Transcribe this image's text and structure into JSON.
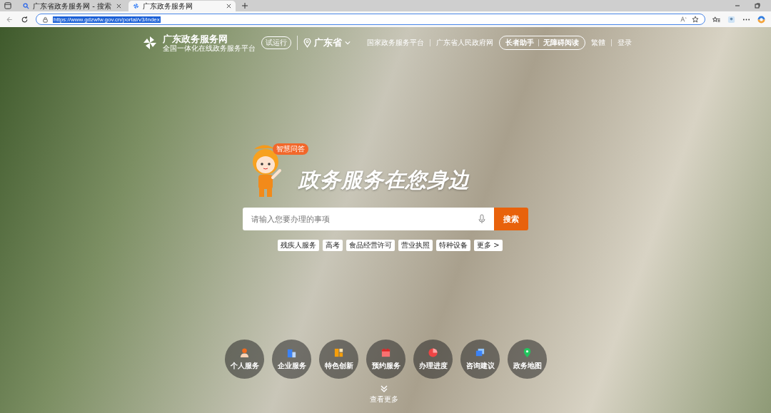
{
  "browser": {
    "tabs": [
      {
        "title": "广东省政务服务网 - 搜索",
        "selected": false,
        "kind": "search"
      },
      {
        "title": "广东政务服务网",
        "selected": true,
        "kind": "site"
      }
    ],
    "url": "https://www.gdzwfw.gov.cn/portal/v3/index"
  },
  "header": {
    "logo_title": "广东政务服务网",
    "logo_subtitle": "全国一体化在线政务服务平台",
    "badge": "试运行",
    "region": "广东省",
    "links": [
      "国家政务服务平台",
      "广东省人民政府网"
    ],
    "assist_buttons": [
      "长者助手",
      "无障碍阅读"
    ],
    "lang": "繁體",
    "login": "登录"
  },
  "hero": {
    "mascot_badge": "智慧问答",
    "headline": "政务服务在您身边",
    "search_placeholder": "请输入您要办理的事项",
    "search_button": "搜索",
    "hot_tags": [
      "残疾人服务",
      "高考",
      "食品经营许可",
      "营业执照",
      "特种设备"
    ],
    "more": "更多 >"
  },
  "services": [
    {
      "label": "个人服务",
      "kind": "person"
    },
    {
      "label": "企业服务",
      "kind": "building"
    },
    {
      "label": "特色创新",
      "kind": "blocks"
    },
    {
      "label": "预约服务",
      "kind": "calendar"
    },
    {
      "label": "办理进度",
      "kind": "pie"
    },
    {
      "label": "咨询建议",
      "kind": "chat"
    },
    {
      "label": "政务地图",
      "kind": "pin"
    }
  ],
  "see_more": "查看更多"
}
